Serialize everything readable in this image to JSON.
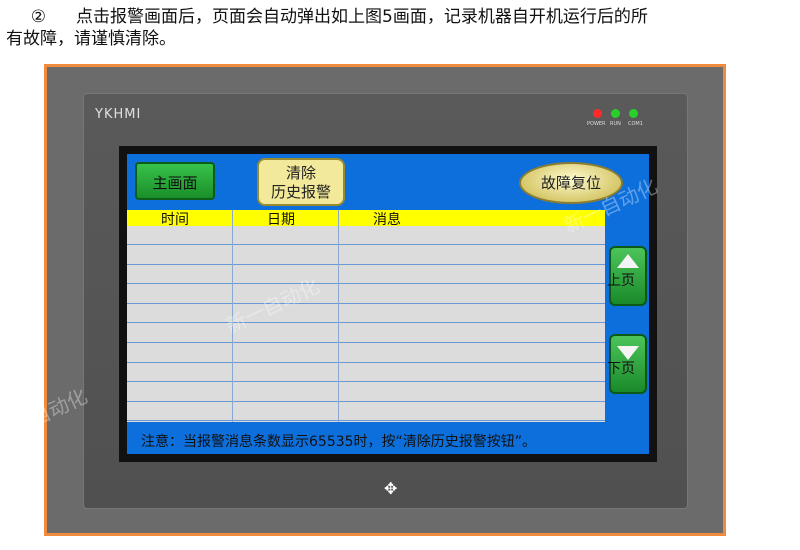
{
  "caption": {
    "number": "②",
    "line1": "点击报警画面后，页面会自动弹出如上图5画面，记录机器自开机运行后的所",
    "line2": "有故障，请谨慎清除。"
  },
  "device": {
    "brand": "YKHMI",
    "leds": [
      {
        "label": "POWER",
        "color": "#ff2a2a"
      },
      {
        "label": "RUN",
        "color": "#2ad02a"
      },
      {
        "label": "COM1",
        "color": "#2ad02a"
      }
    ]
  },
  "hmi": {
    "main_button": "主画面",
    "clear_button_line1": "清除",
    "clear_button_line2": "历史报警",
    "reset_button": "故障复位",
    "table": {
      "headers": [
        "时间",
        "日期",
        "消息"
      ],
      "row_count": 10
    },
    "page_up": "上页",
    "page_down": "下页",
    "note": "注意：当报警消息条数显示65535时，按“清除历史报警按钮”。",
    "colors": {
      "background": "#0d6fdc",
      "header": "#ffff00",
      "table": "#dcdcdc"
    }
  },
  "watermark": "新一自动化"
}
